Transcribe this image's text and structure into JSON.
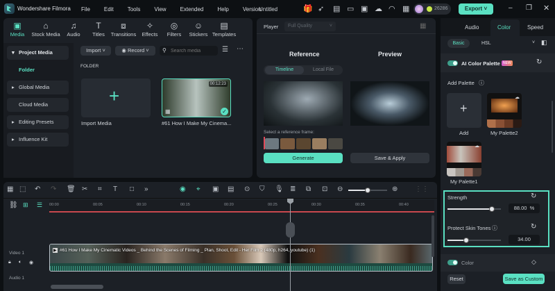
{
  "app": {
    "name": "Wondershare Filmora",
    "project": "Untitled",
    "credits": "26286",
    "export": "Export"
  },
  "menu": [
    "File",
    "Edit",
    "Tools",
    "View",
    "Extended",
    "Help",
    "Version"
  ],
  "toolbar": [
    {
      "label": "Media",
      "icon": "media-icon",
      "active": true
    },
    {
      "label": "Stock Media",
      "icon": "stock-media-icon"
    },
    {
      "label": "Audio",
      "icon": "music-note-icon"
    },
    {
      "label": "Titles",
      "icon": "titles-icon"
    },
    {
      "label": "Transitions",
      "icon": "transitions-icon"
    },
    {
      "label": "Effects",
      "icon": "effects-icon"
    },
    {
      "label": "Filters",
      "icon": "filters-icon"
    },
    {
      "label": "Stickers",
      "icon": "stickers-icon"
    },
    {
      "label": "Templates",
      "icon": "templates-icon"
    }
  ],
  "sidebar": [
    {
      "label": "Project Media",
      "expand": "▾"
    },
    {
      "label": "Folder",
      "active": true
    },
    {
      "label": "Global Media",
      "expand": "▸"
    },
    {
      "label": "Cloud Media"
    },
    {
      "label": "Editing Presets",
      "expand": "▸"
    },
    {
      "label": "Influence Kit",
      "expand": "▸"
    }
  ],
  "media": {
    "import": "Import",
    "record": "Record",
    "search_placeholder": "Search media",
    "folder_label": "FOLDER",
    "import_media": "Import Media",
    "clip_name": "#61 How I Make My Cinema...",
    "clip_duration": "00:12:23"
  },
  "player": {
    "label": "Player",
    "quality": "Full Quality",
    "reference": "Reference",
    "preview": "Preview",
    "tab_timeline": "Timeline",
    "tab_local": "Local File",
    "select_frame": "Select a reference frame:",
    "generate": "Generate",
    "save_apply": "Save & Apply"
  },
  "right": {
    "tabs": [
      "Audio",
      "Color",
      "Speed"
    ],
    "active_tab": "Color",
    "subtabs": [
      "Basic",
      "HSL"
    ],
    "ai_palette": "AI Color Palette",
    "new_badge": "NEW",
    "add_palette": "Add Palette",
    "add": "Add",
    "palettes": [
      "My Palette2",
      "My Palette1"
    ],
    "strength_label": "Strength",
    "strength": "88.00",
    "strength_unit": "%",
    "strength_fraction": 0.88,
    "skin_label": "Protect Skin Tones",
    "skin": "34.00",
    "skin_fraction": 0.34,
    "color_label": "Color",
    "reset": "Reset",
    "save_custom": "Save as Custom"
  },
  "timeline": {
    "ticks": [
      "00:00",
      "00:05",
      "00:10",
      "00:15",
      "00:20",
      "00:25",
      "00:30",
      "00:35",
      "00:40"
    ],
    "video_track": "Video 1",
    "audio_track": "Audio 1",
    "clip_title": "#61 How I Make My Cinematic Videos _ Behind the Scenes of Filming _ Plan, Shoot, Edit - Her Film 2 (480p, h264, youtube) (1)",
    "zoom_fraction": 0.5
  },
  "colors": {
    "accent": "#5ae0c2",
    "panel": "#1c2026",
    "bg": "#0d1013"
  }
}
